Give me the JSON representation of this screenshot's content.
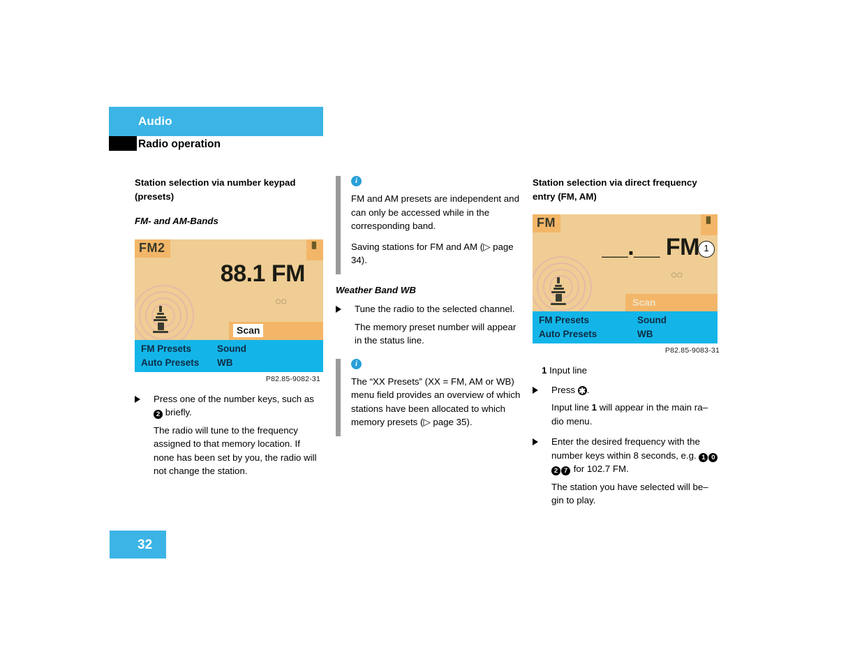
{
  "header": {
    "section_title": "Audio",
    "subsection_title": "Radio operation"
  },
  "footer": {
    "page_number": "32"
  },
  "colors": {
    "brand_blue": "#3cb4e5",
    "screen_amber": "#efcd94",
    "screen_orange": "#f3b669",
    "screen_menu_blue": "#13b5e8",
    "note_bar_gray": "#9a9a9a",
    "info_icon_blue": "#2a9fd8"
  },
  "left_column": {
    "heading": "Station selection via number keypad (presets)",
    "subheading": "FM- and AM-Bands",
    "figure": {
      "band_tag": "FM2",
      "frequency": "88.1 FM",
      "stereo_icon": "stereo-icon",
      "scan_label": "Scan",
      "menu_items": [
        "FM Presets",
        "Sound",
        "Auto Presets",
        "WB"
      ],
      "caption": "P82.85-9082-31"
    },
    "steps": [
      {
        "bullet": "▶",
        "text_before": "Press one of the number keys, such as",
        "key": "2",
        "text_after": "briefly."
      }
    ],
    "paragraph": "The radio will tune to the frequency assigned to that memory location. If none has been set by you, the radio will not change the station."
  },
  "middle_column": {
    "note_1": {
      "icon": "info-icon",
      "paragraphs": [
        "FM and AM presets are independent and can only be accessed while in the corresponding band.",
        "Saving stations for FM and AM (▷ page 34)."
      ]
    },
    "subheading": "Weather Band WB",
    "step": {
      "bullet": "▶",
      "text": "Tune the radio to the selected channel."
    },
    "paragraph": "The memory preset number will appear in the status line.",
    "note_2": {
      "icon": "info-icon",
      "paragraphs": [
        "The “XX Presets” (XX = FM, AM or WB) menu field provides an overview of which stations have been allocated to which memory presets (▷ page 35)."
      ]
    }
  },
  "right_column": {
    "heading": "Station selection via direct frequency entry (FM, AM)",
    "figure": {
      "band_tag": "FM",
      "frequency_blank": "__.__ FM",
      "stereo_icon": "stereo-icon",
      "scan_label": "Scan",
      "menu_items": [
        "FM Presets",
        "Sound",
        "Auto Presets",
        "WB"
      ],
      "marker": "1",
      "caption": "P82.85-9083-31"
    },
    "legend": {
      "number": "1",
      "label": "Input line"
    },
    "steps": [
      {
        "bullet": "▶",
        "text_before": "Press",
        "key": "✱",
        "text_after": "."
      },
      {
        "bullet": "▶",
        "text_before": "Enter the desired frequency with the number keys within 8 seconds, e.g.",
        "keys": [
          "1",
          "0",
          "2",
          "7"
        ],
        "text_after": "for 102.7 FM."
      }
    ],
    "paragraph_1_a": "Input line",
    "paragraph_1_b": "1",
    "paragraph_1_c": "will appear in the main ra–dio menu.",
    "paragraph_2": "The station you have selected will be–gin to play."
  }
}
